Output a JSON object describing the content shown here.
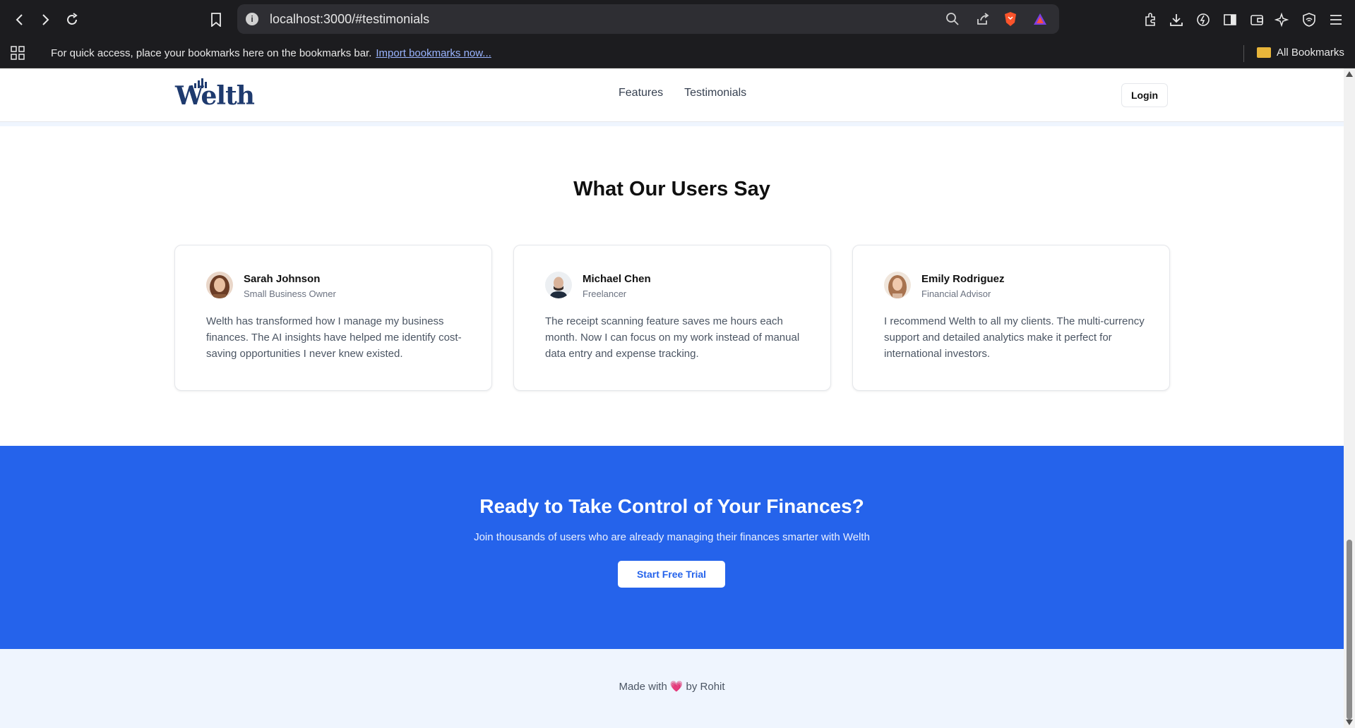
{
  "browser": {
    "url": "localhost:3000/#testimonials",
    "bookmarks_prompt": "For quick access, place your bookmarks here on the bookmarks bar.",
    "import_link": "Import bookmarks now...",
    "all_bookmarks": "All Bookmarks"
  },
  "header": {
    "logo_text": "Welth",
    "nav": [
      "Features",
      "Testimonials"
    ],
    "login_label": "Login"
  },
  "testimonials": {
    "title": "What Our Users Say",
    "items": [
      {
        "name": "Sarah Johnson",
        "role": "Small Business Owner",
        "quote": "Welth has transformed how I manage my business finances. The AI insights have helped me identify cost-saving opportunities I never knew existed."
      },
      {
        "name": "Michael Chen",
        "role": "Freelancer",
        "quote": "The receipt scanning feature saves me hours each month. Now I can focus on my work instead of manual data entry and expense tracking."
      },
      {
        "name": "Emily Rodriguez",
        "role": "Financial Advisor",
        "quote": "I recommend Welth to all my clients. The multi-currency support and detailed analytics make it perfect for international investors."
      }
    ]
  },
  "cta": {
    "title": "Ready to Take Control of Your Finances?",
    "subtitle": "Join thousands of users who are already managing their finances smarter with Welth",
    "button": "Start Free Trial"
  },
  "footer": {
    "made_with": "Made with",
    "by": "by Rohit"
  },
  "colors": {
    "primary": "#2563eb",
    "logo": "#1e3a6e",
    "footer_bg": "#eff5fe",
    "heart": "#ec4899"
  }
}
